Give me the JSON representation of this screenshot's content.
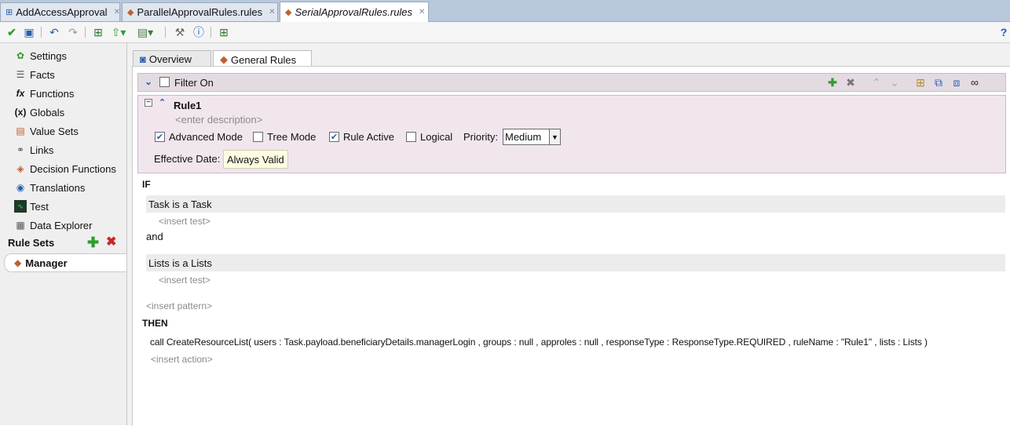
{
  "doc_tabs": [
    {
      "label": "AddAccessApproval",
      "active": false
    },
    {
      "label": "ParallelApprovalRules.rules",
      "active": false
    },
    {
      "label": "SerialApprovalRules.rules",
      "active": true
    }
  ],
  "toolbar": {
    "icons": [
      "validate-check-icon",
      "save-icon",
      "undo-icon",
      "redo-icon",
      "deploy-icon",
      "up-arrow-dropdown-icon",
      "export-dropdown-icon",
      "wrench-icon",
      "info-icon",
      "test-run-icon",
      "help-icon"
    ]
  },
  "sidebar": {
    "items": [
      {
        "label": "Settings",
        "icon": "settings-icon"
      },
      {
        "label": "Facts",
        "icon": "facts-icon"
      },
      {
        "label": "Functions",
        "icon": "functions-icon"
      },
      {
        "label": "Globals",
        "icon": "globals-icon"
      },
      {
        "label": "Value Sets",
        "icon": "value-sets-icon"
      },
      {
        "label": "Links",
        "icon": "links-icon"
      },
      {
        "label": "Decision Functions",
        "icon": "decision-functions-icon"
      },
      {
        "label": "Translations",
        "icon": "translations-icon"
      },
      {
        "label": "Test",
        "icon": "test-icon"
      },
      {
        "label": "Data Explorer",
        "icon": "data-explorer-icon"
      }
    ],
    "rule_sets_label": "Rule Sets",
    "ruleset_item": "Manager"
  },
  "editor_tabs": [
    {
      "label": "Overview",
      "active": false
    },
    {
      "label": "General Rules",
      "active": true
    }
  ],
  "filter": {
    "label": "Filter On",
    "checked": false
  },
  "rule": {
    "name": "Rule1",
    "description_placeholder": "<enter description>",
    "advanced_mode": {
      "label": "Advanced Mode",
      "checked": true
    },
    "tree_mode": {
      "label": "Tree Mode",
      "checked": false
    },
    "rule_active": {
      "label": "Rule Active",
      "checked": true
    },
    "logical": {
      "label": "Logical",
      "checked": false
    },
    "priority_label": "Priority:",
    "priority_value": "Medium",
    "effective_date_label": "Effective Date:",
    "effective_date_value": "Always Valid"
  },
  "body": {
    "if_label": "IF",
    "pattern1": "Task is a Task",
    "insert_test_1": "<insert test>",
    "and_label": "and",
    "pattern2": "Lists is a Lists",
    "insert_test_2": "<insert test>",
    "insert_pattern": "<insert pattern>",
    "then_label": "THEN",
    "action": "call CreateResourceList( users : Task.payload.beneficiaryDetails.managerLogin , groups : null , approles : null , responseType : ResponseType.REQUIRED , ruleName : \"Rule1\" , lists : Lists )",
    "insert_action": "<insert action>"
  },
  "colors": {
    "rule_bg": "#f1e6ee",
    "filter_bg": "#e4dbe2",
    "tabbar_bg": "#b9c8dc",
    "add_green": "#2f9e2f",
    "delete_red": "#c62828"
  }
}
